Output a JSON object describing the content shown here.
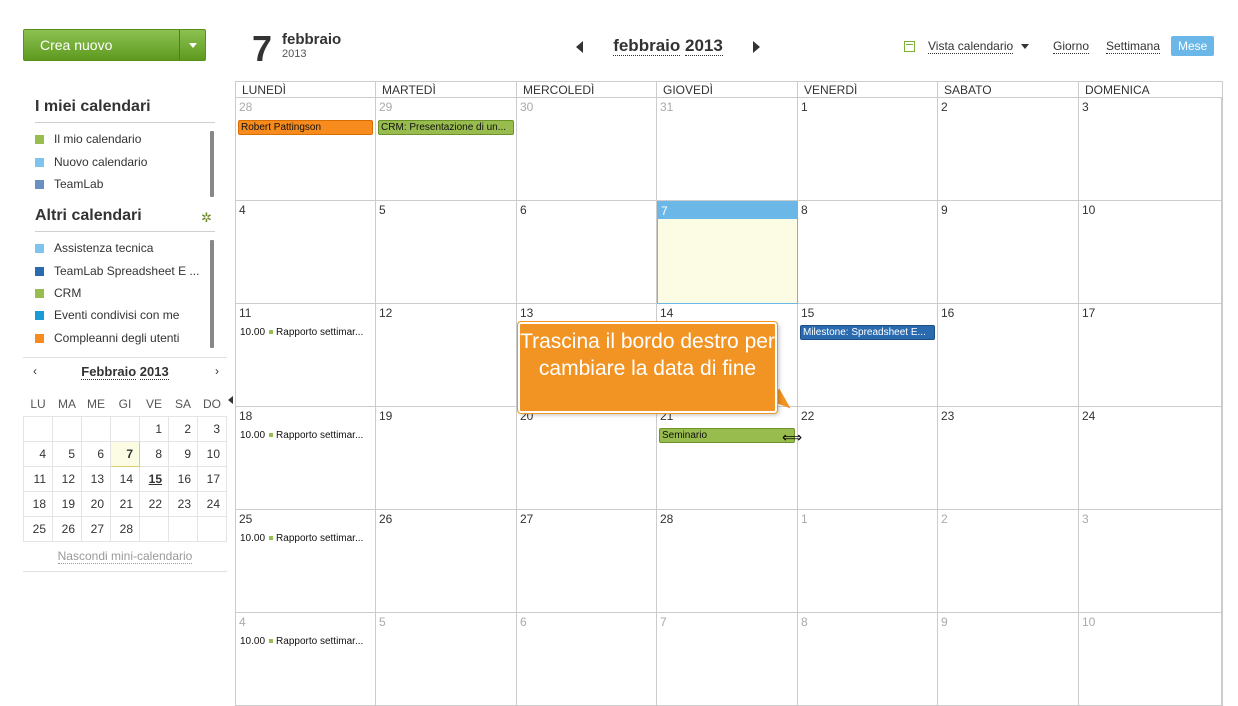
{
  "create": {
    "label": "Crea nuovo"
  },
  "my_calendars": {
    "title": "I miei calendari",
    "items": [
      {
        "label": "Il mio calendario",
        "color": "#98bc4d"
      },
      {
        "label": "Nuovo calendario",
        "color": "#7fc4ef"
      },
      {
        "label": "TeamLab",
        "color": "#6b8fc2"
      }
    ]
  },
  "other_calendars": {
    "title": "Altri calendari",
    "items": [
      {
        "label": "Assistenza tecnica",
        "color": "#7fc4ef"
      },
      {
        "label": "TeamLab Spreadsheet E ...",
        "color": "#2a6bb0"
      },
      {
        "label": "CRM",
        "color": "#98bc4d"
      },
      {
        "label": "Eventi condivisi con me",
        "color": "#1a9bd7"
      },
      {
        "label": "Compleanni degli utenti",
        "color": "#f78b1d"
      }
    ]
  },
  "mini": {
    "title_month": "Febbraio",
    "title_year": "2013",
    "dow": [
      "LU",
      "MA",
      "ME",
      "GI",
      "VE",
      "SA",
      "DO"
    ],
    "weeks": [
      [
        "",
        "",
        "",
        "",
        "1",
        "2",
        "3"
      ],
      [
        "4",
        "5",
        "6",
        "7",
        "8",
        "9",
        "10"
      ],
      [
        "11",
        "12",
        "13",
        "14",
        "15",
        "16",
        "17"
      ],
      [
        "18",
        "19",
        "20",
        "21",
        "22",
        "23",
        "24"
      ],
      [
        "25",
        "26",
        "27",
        "28",
        "",
        "",
        ""
      ]
    ],
    "hide_label": "Nascondi mini-calendario"
  },
  "header": {
    "day": "7",
    "month": "febbraio",
    "year": "2013",
    "nav_month": "febbraio",
    "nav_year": "2013",
    "view_label": "Vista calendario",
    "day_btn": "Giorno",
    "week_btn": "Settimana",
    "month_btn": "Mese"
  },
  "grid": {
    "dow": [
      "LUNEDÌ",
      "MARTEDÌ",
      "MERCOLEDÌ",
      "GIOVEDÌ",
      "VENERDÌ",
      "SABATO",
      "DOMENICA"
    ],
    "weeks": [
      [
        "28",
        "29",
        "30",
        "31",
        "1",
        "2",
        "3"
      ],
      [
        "4",
        "5",
        "6",
        "7",
        "8",
        "9",
        "10"
      ],
      [
        "11",
        "12",
        "13",
        "14",
        "15",
        "16",
        "17"
      ],
      [
        "18",
        "19",
        "20",
        "21",
        "22",
        "23",
        "24"
      ],
      [
        "25",
        "26",
        "27",
        "28",
        "1",
        "2",
        "3"
      ],
      [
        "4",
        "5",
        "6",
        "7",
        "8",
        "9",
        "10"
      ]
    ]
  },
  "events": {
    "birthday": "Robert Pattingson",
    "crm": "CRM: Presentazione di un...",
    "milestone": "Milestone: Spreadsheet E...",
    "seminario": "Seminario",
    "rapporto_time": "10.00",
    "rapporto": "Rapporto settimar..."
  },
  "tooltip": {
    "text": "Trascina il bordo destro per cambiare la data di fine"
  }
}
